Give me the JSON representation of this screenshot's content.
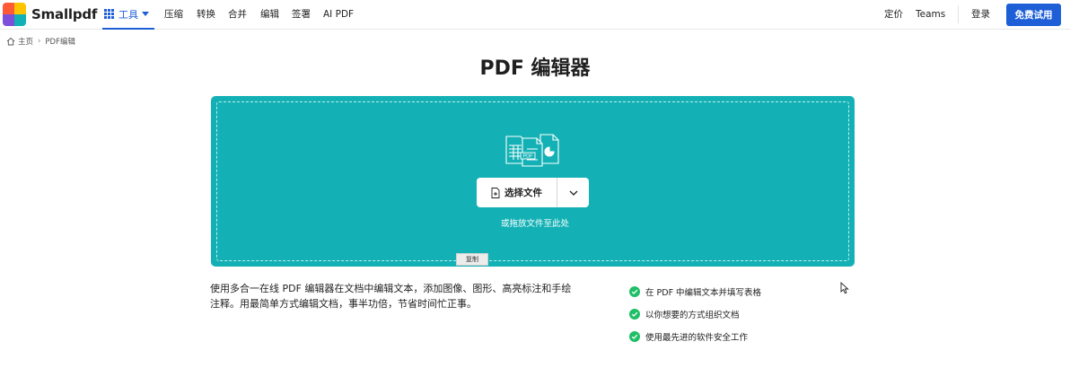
{
  "brand": {
    "name": "Smallpdf",
    "logo_colors": [
      "#ff5a36",
      "#ffc400",
      "#7d4fdb",
      "#13b1b5"
    ]
  },
  "nav": {
    "tools_label": "工具",
    "links": [
      "压缩",
      "转换",
      "合并",
      "编辑",
      "签署",
      "AI PDF"
    ],
    "pricing": "定价",
    "teams": "Teams",
    "login": "登录",
    "free_trial": "免费试用"
  },
  "breadcrumb": {
    "home": "主页",
    "current": "PDF编辑"
  },
  "page_title": "PDF 编辑器",
  "dropzone": {
    "choose_label": "选择文件",
    "hint": "或拖放文件至此处",
    "copy_tab": "复制",
    "illustration_badge": "PDF"
  },
  "description": "使用多合一在线 PDF 编辑器在文档中编辑文本，添加图像、图形、高亮标注和手绘注释。用最简单方式编辑文档，事半功倍，节省时间忙正事。",
  "features": [
    "在 PDF 中编辑文本并填写表格",
    "以你想要的方式组织文档",
    "使用最先进的软件安全工作"
  ],
  "colors": {
    "accent": "#1e5fd8",
    "dropzone": "#13b1b5",
    "check": "#1fbf67"
  }
}
